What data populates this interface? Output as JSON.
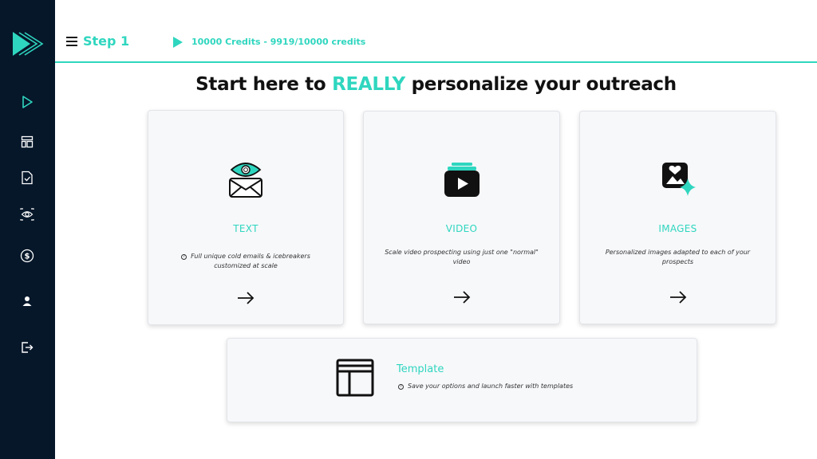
{
  "header": {
    "step_title": "Step 1",
    "credits": "10000 Credits - 9919/10000 credits"
  },
  "headline": {
    "before": "Start here to ",
    "highlight": "REALLY",
    "after": " personalize your outreach"
  },
  "sidebar": {
    "items": [
      {
        "icon": "play-icon"
      },
      {
        "icon": "layout-icon"
      },
      {
        "icon": "document-check-icon"
      },
      {
        "icon": "eye-icon"
      },
      {
        "icon": "dollar-icon"
      },
      {
        "icon": "user-icon"
      },
      {
        "icon": "logout-icon"
      }
    ]
  },
  "cards": [
    {
      "title": "TEXT",
      "description": "Full unique cold emails & icebreakers customized at scale",
      "icon": "email-eye-icon"
    },
    {
      "title": "VIDEO",
      "description": "Scale video prospecting using just one \"normal\" video",
      "icon": "video-stack-icon"
    },
    {
      "title": "IMAGES",
      "description": "Personalized images adapted to each of your prospects",
      "icon": "image-sparkle-icon"
    }
  ],
  "template_card": {
    "title": "Template",
    "description": "Save your options and launch faster with templates",
    "icon": "template-layout-icon"
  },
  "colors": {
    "accent": "#2fd6bf",
    "sidebar": "#06172a",
    "card_bg": "#f7f8fa"
  }
}
